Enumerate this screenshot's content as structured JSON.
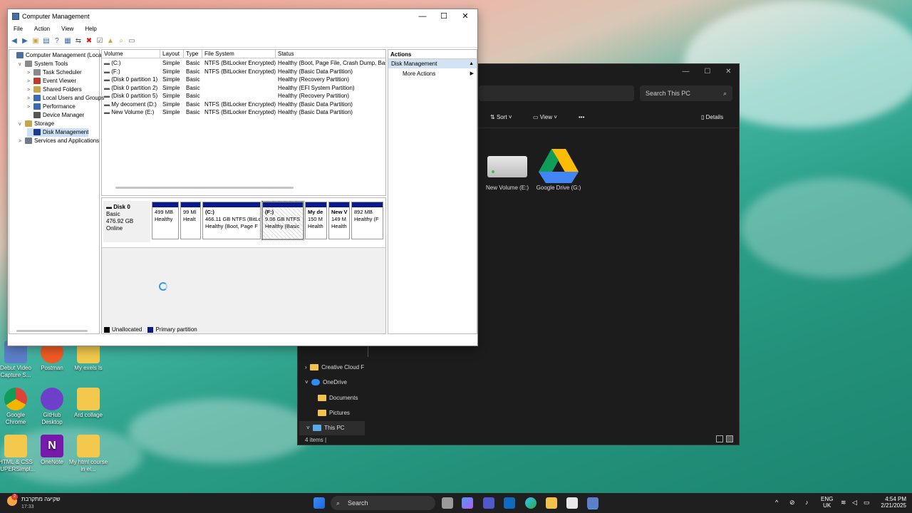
{
  "cm": {
    "title": "Computer Management",
    "menu": [
      "File",
      "Action",
      "View",
      "Help"
    ],
    "tree": [
      {
        "label": "Computer Management (Local",
        "depth": 0,
        "expander": ""
      },
      {
        "label": "System Tools",
        "depth": 1,
        "expander": "v"
      },
      {
        "label": "Task Scheduler",
        "depth": 2,
        "expander": ">"
      },
      {
        "label": "Event Viewer",
        "depth": 2,
        "expander": ">"
      },
      {
        "label": "Shared Folders",
        "depth": 2,
        "expander": ">"
      },
      {
        "label": "Local Users and Groups",
        "depth": 2,
        "expander": ">"
      },
      {
        "label": "Performance",
        "depth": 2,
        "expander": ">"
      },
      {
        "label": "Device Manager",
        "depth": 2,
        "expander": ""
      },
      {
        "label": "Storage",
        "depth": 1,
        "expander": "v"
      },
      {
        "label": "Disk Management",
        "depth": 2,
        "expander": ""
      },
      {
        "label": "Services and Applications",
        "depth": 1,
        "expander": ">"
      }
    ],
    "columns": [
      "Volume",
      "Layout",
      "Type",
      "File System",
      "Status"
    ],
    "volumes": [
      [
        "(C:)",
        "Simple",
        "Basic",
        "NTFS (BitLocker Encrypted)",
        "Healthy (Boot, Page File, Crash Dump, Bas"
      ],
      [
        "(F:)",
        "Simple",
        "Basic",
        "NTFS (BitLocker Encrypted)",
        "Healthy (Basic Data Partition)"
      ],
      [
        "(Disk 0 partition 1)",
        "Simple",
        "Basic",
        "",
        "Healthy (Recovery Partition)"
      ],
      [
        "(Disk 0 partition 2)",
        "Simple",
        "Basic",
        "",
        "Healthy (EFI System Partition)"
      ],
      [
        "(Disk 0 partition 5)",
        "Simple",
        "Basic",
        "",
        "Healthy (Recovery Partition)"
      ],
      [
        "My decoment (D:)",
        "Simple",
        "Basic",
        "NTFS (BitLocker Encrypted)",
        "Healthy (Basic Data Partition)"
      ],
      [
        "New Volume (E:)",
        "Simple",
        "Basic",
        "NTFS (BitLocker Encrypted)",
        "Healthy (Basic Data Partition)"
      ]
    ],
    "disk": {
      "name": "Disk 0",
      "type": "Basic",
      "size": "476.92 GB",
      "state": "Online"
    },
    "partitions": [
      {
        "l1": "",
        "l2": "499 MB",
        "l3": "Healthy",
        "hatched": false
      },
      {
        "l1": "",
        "l2": "99 MI",
        "l3": "Healt",
        "hatched": false
      },
      {
        "l1": "(C:)",
        "l2": "466.11 GB NTFS (BitLo",
        "l3": "Healthy (Boot, Page F",
        "hatched": false
      },
      {
        "l1": "(F:)",
        "l2": "9.06 GB NTFS",
        "l3": "Healthy (Basic",
        "hatched": true
      },
      {
        "l1": "My de",
        "l2": "150 M",
        "l3": "Health",
        "hatched": false
      },
      {
        "l1": "New V",
        "l2": "149 M",
        "l3": "Health",
        "hatched": false
      },
      {
        "l1": "",
        "l2": "892 MB",
        "l3": "Healthy (F",
        "hatched": false
      }
    ],
    "legend": [
      "Unallocated",
      "Primary partition"
    ],
    "actions": {
      "header": "Actions",
      "section": "Disk Management",
      "item": "More Actions"
    }
  },
  "explorer": {
    "search_placeholder": "Search This PC",
    "sort": "Sort",
    "view": "View",
    "more": "•••",
    "details": "Details",
    "tiles": [
      "New Volume (E:)",
      "Google Drive (G:)"
    ],
    "nav": [
      "Creative Cloud F",
      "OneDrive",
      "Documents",
      "Pictures",
      "This PC"
    ],
    "status": "4 items"
  },
  "desktop": {
    "icons": [
      "Debut Video Capture S...",
      "Postman",
      "My exels ls",
      "Google Chrome",
      "GitHub Desktop",
      "Ard collage",
      "HTML & CSS SUPERSimpl...",
      "OneNote",
      "My html course in el..."
    ]
  },
  "taskbar": {
    "weather": "שקיעה מתקרבת",
    "weather_time": "17:33",
    "badge": "2",
    "search": "Search",
    "lang": "ENG",
    "region": "UK",
    "time": "4:54 PM",
    "date": "2/21/2025"
  }
}
